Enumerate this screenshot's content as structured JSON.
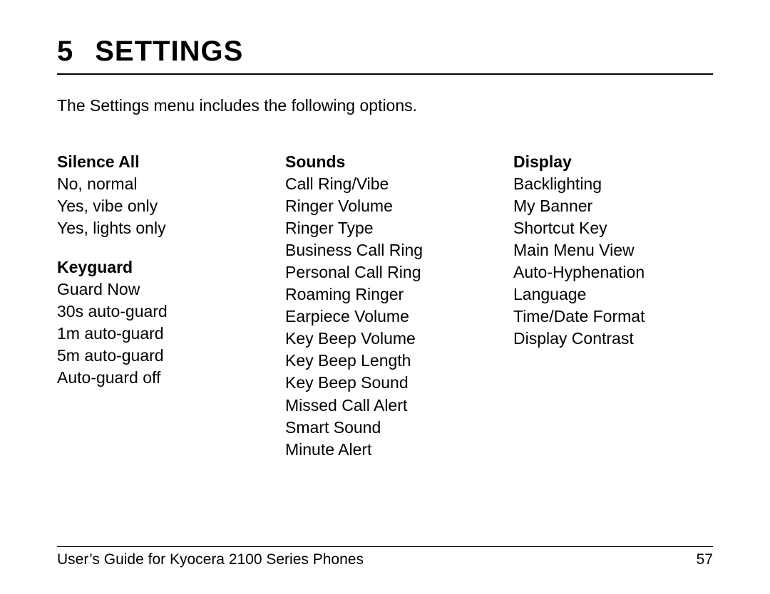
{
  "chapter": {
    "number": "5",
    "title": "SETTINGS"
  },
  "intro": "The Settings menu includes the following options.",
  "columns": [
    {
      "groups": [
        {
          "title": "Silence All",
          "items": [
            "No, normal",
            "Yes, vibe only",
            "Yes, lights only"
          ]
        },
        {
          "title": "Keyguard",
          "items": [
            "Guard Now",
            "30s auto-guard",
            "1m auto-guard",
            "5m auto-guard",
            "Auto-guard off"
          ]
        }
      ]
    },
    {
      "groups": [
        {
          "title": "Sounds",
          "items": [
            "Call Ring/Vibe",
            "Ringer Volume",
            "Ringer Type",
            "Business Call Ring",
            "Personal Call Ring",
            "Roaming Ringer",
            "Earpiece Volume",
            "Key Beep Volume",
            "Key Beep Length",
            "Key Beep Sound",
            "Missed Call Alert",
            "Smart Sound",
            "Minute Alert"
          ]
        }
      ]
    },
    {
      "groups": [
        {
          "title": "Display",
          "items": [
            "Backlighting",
            "My Banner",
            "Shortcut Key",
            "Main Menu View",
            "Auto-Hyphenation",
            "Language",
            "Time/Date Format",
            "Display Contrast"
          ]
        }
      ]
    }
  ],
  "footer": {
    "book_title": "User’s Guide for Kyocera 2100 Series Phones",
    "page_number": "57"
  }
}
